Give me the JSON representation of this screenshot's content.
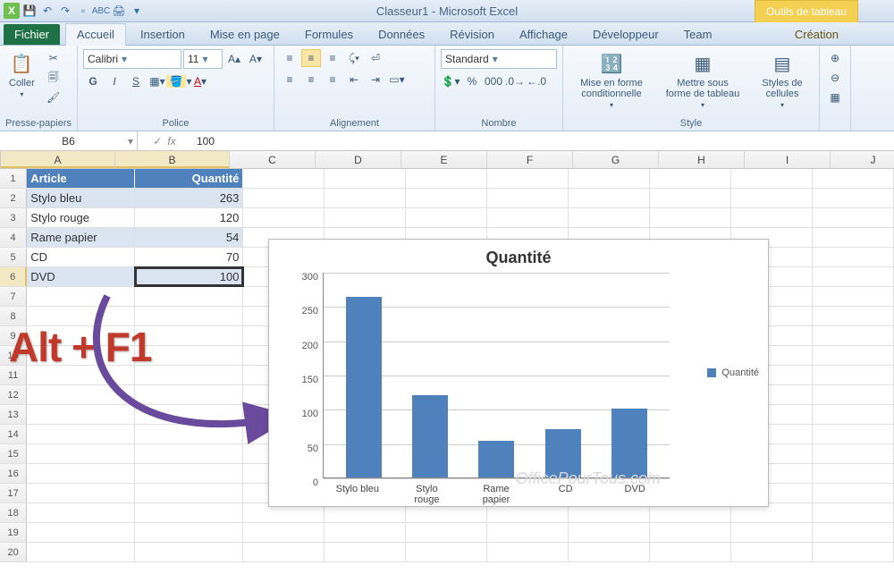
{
  "window": {
    "title": "Classeur1  -  Microsoft Excel"
  },
  "tabtool_highlight": "Outils de tableau",
  "tabs": {
    "file": "Fichier",
    "items": [
      "Accueil",
      "Insertion",
      "Mise en page",
      "Formules",
      "Données",
      "Révision",
      "Affichage",
      "Développeur",
      "Team"
    ],
    "creation": "Création",
    "active_index": 0
  },
  "ribbon": {
    "groups": {
      "clipboard": "Presse-papiers",
      "paste_label": "Coller",
      "font": "Police",
      "font_name": "Calibri",
      "font_size": "11",
      "align": "Alignement",
      "number": "Nombre",
      "number_format": "Standard",
      "style": "Style",
      "style_cond": "Mise en forme conditionnelle",
      "style_table": "Mettre sous forme de tableau",
      "style_cell": "Styles de cellules"
    }
  },
  "namebox": "B6",
  "fx_value": "100",
  "columns": [
    "A",
    "B",
    "C",
    "D",
    "E",
    "F",
    "G",
    "H",
    "I",
    "J"
  ],
  "table_headers": {
    "a": "Article",
    "b": "Quantité"
  },
  "table_rows": [
    {
      "article": "Stylo bleu",
      "qty": "263"
    },
    {
      "article": "Stylo rouge",
      "qty": "120"
    },
    {
      "article": "Rame papier",
      "qty": "54"
    },
    {
      "article": "CD",
      "qty": "70"
    },
    {
      "article": "DVD",
      "qty": "100"
    }
  ],
  "annotation": "Alt + F1",
  "watermark": "OfficePourTous.com",
  "chart_data": {
    "type": "bar",
    "title": "Quantité",
    "xlabel": "",
    "ylabel": "",
    "ylim": [
      0,
      300
    ],
    "yticks": [
      0,
      50,
      100,
      150,
      200,
      250,
      300
    ],
    "categories": [
      "Stylo bleu",
      "Stylo rouge",
      "Rame papier",
      "CD",
      "DVD"
    ],
    "series": [
      {
        "name": "Quantité",
        "values": [
          263,
          120,
          54,
          70,
          100
        ]
      }
    ]
  }
}
